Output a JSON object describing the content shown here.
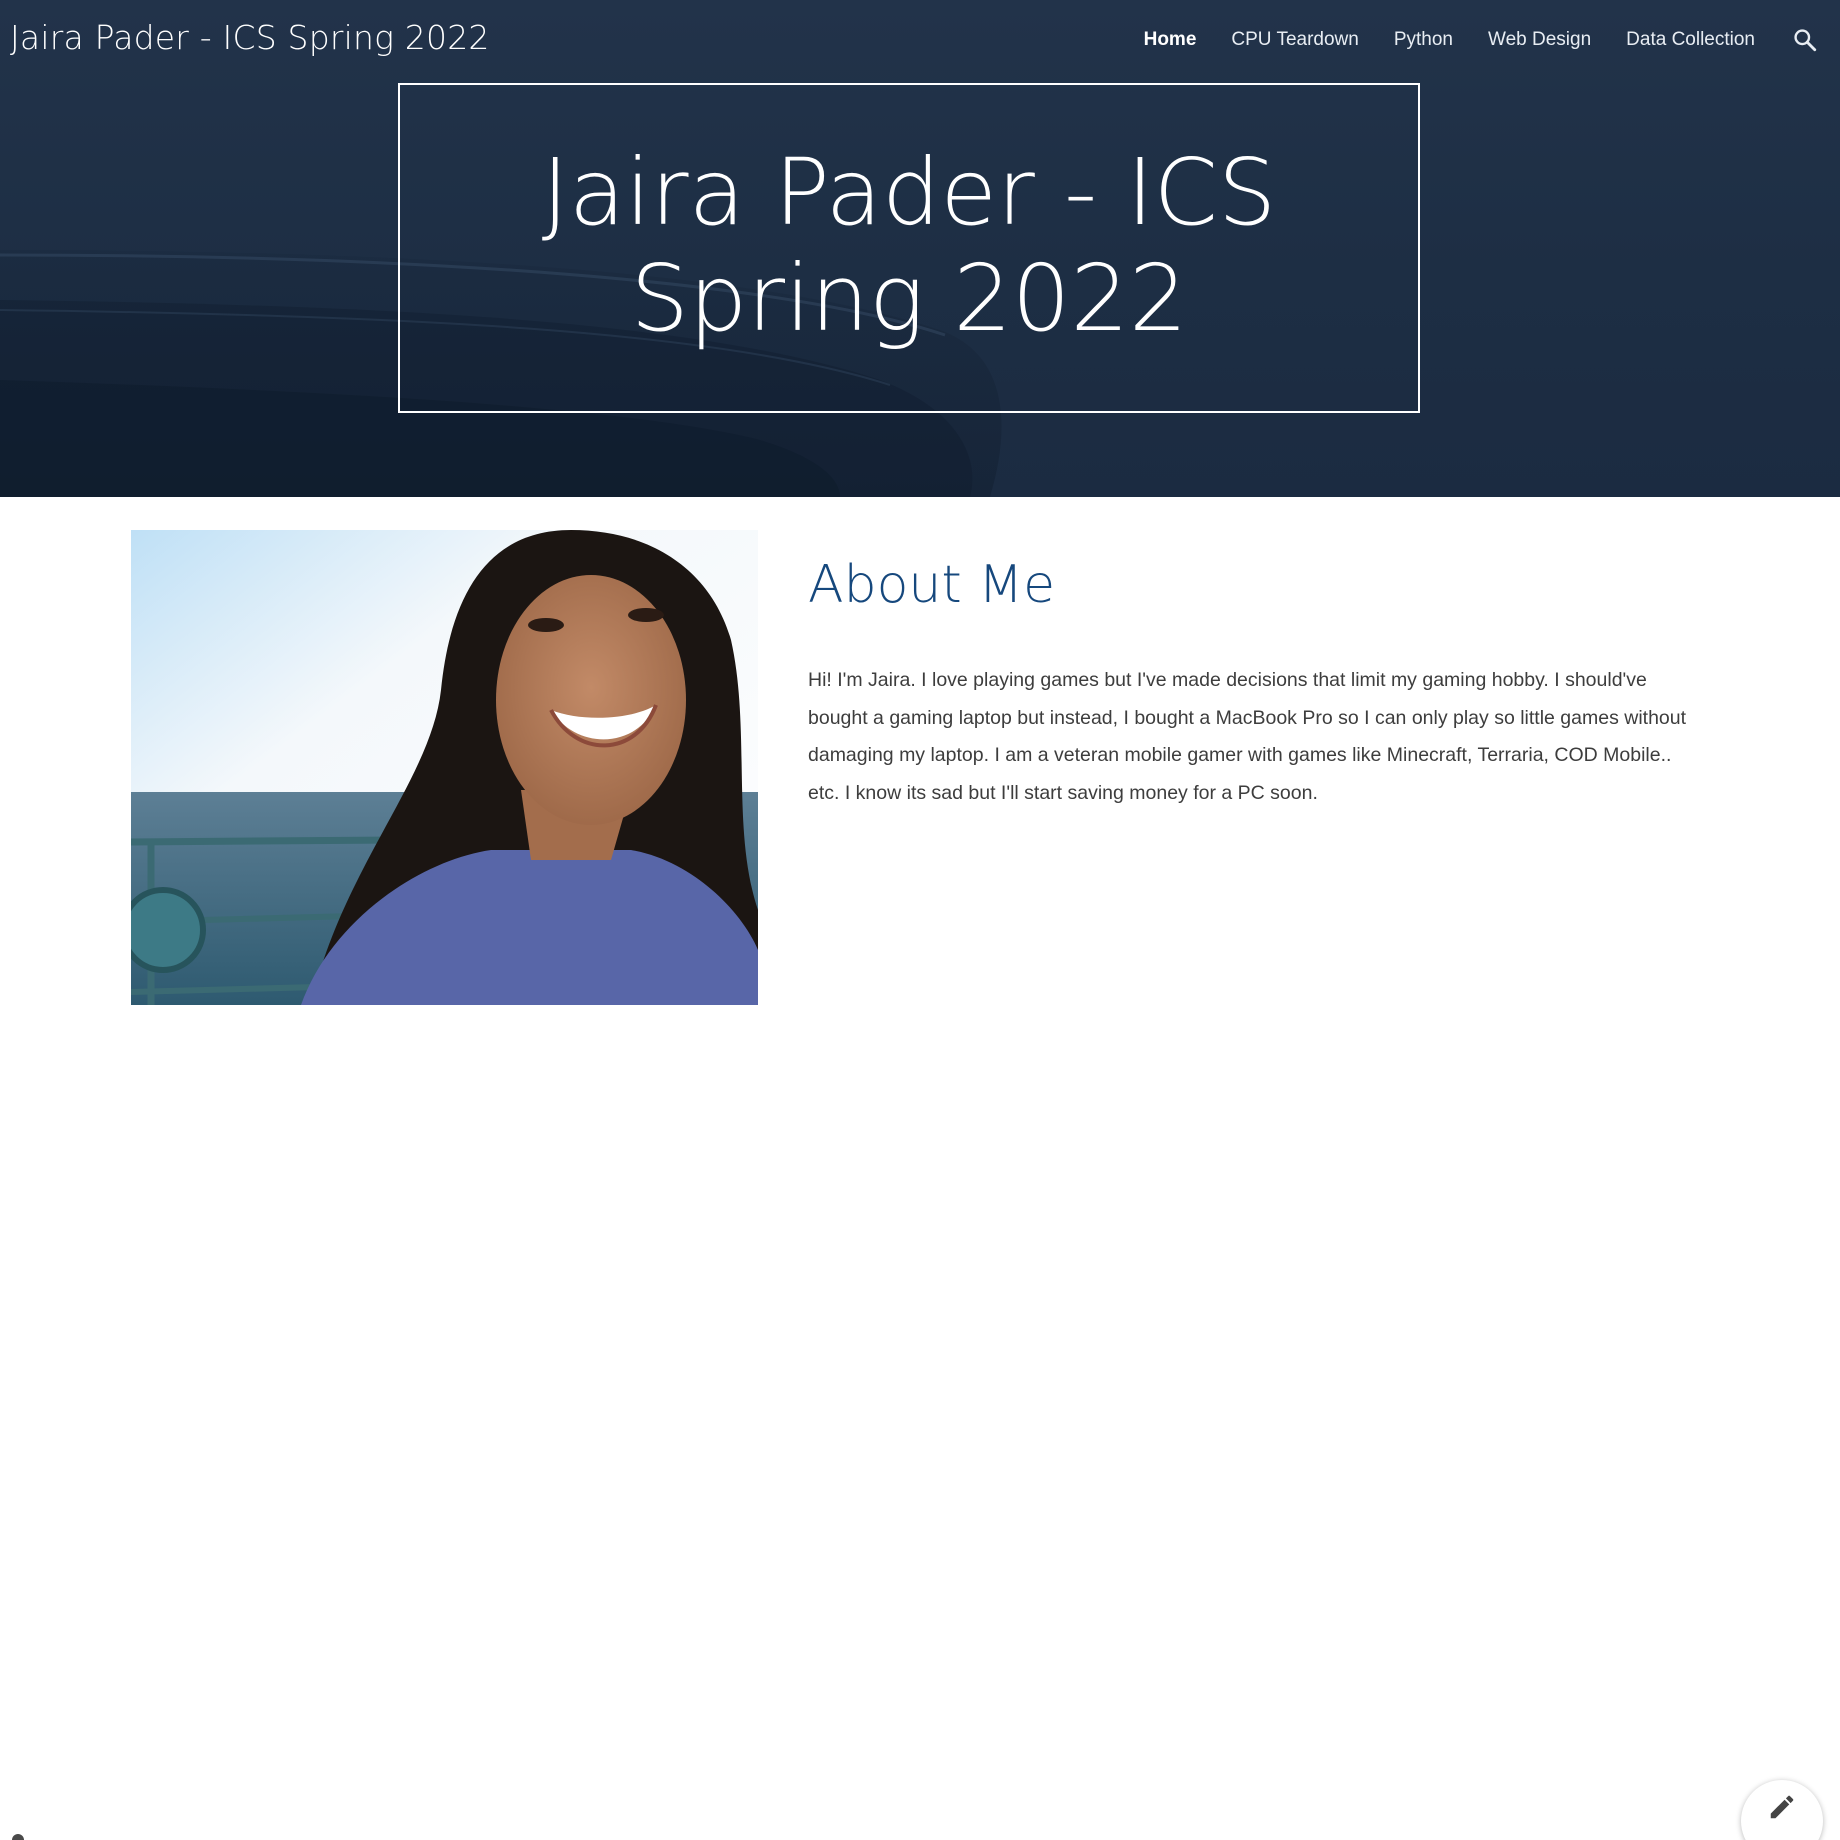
{
  "header": {
    "site_title": "Jaira Pader - ICS Spring 2022",
    "hero_title": "Jaira Pader - ICS Spring 2022"
  },
  "nav": {
    "items": [
      {
        "label": "Home",
        "active": true
      },
      {
        "label": "CPU Teardown",
        "active": false
      },
      {
        "label": "Python",
        "active": false
      },
      {
        "label": "Web Design",
        "active": false
      },
      {
        "label": "Data Collection",
        "active": false
      }
    ],
    "search_icon": "search-icon"
  },
  "about": {
    "heading": "About Me",
    "body": "Hi! I'm Jaira. I love playing games but I've made decisions that limit my gaming hobby. I should've bought a gaming laptop but instead, I bought a MacBook Pro so I can only play so little games without damaging my laptop.  I am a veteran mobile gamer with games like Minecraft, Terraria, COD Mobile.. etc.  I know its sad but I'll start saving money for a PC soon."
  },
  "fab": {
    "icon": "pencil-icon"
  },
  "colors": {
    "hero_bg": "#1d2e44",
    "heading_blue": "#16487d",
    "body_text": "#3d3d3d"
  }
}
